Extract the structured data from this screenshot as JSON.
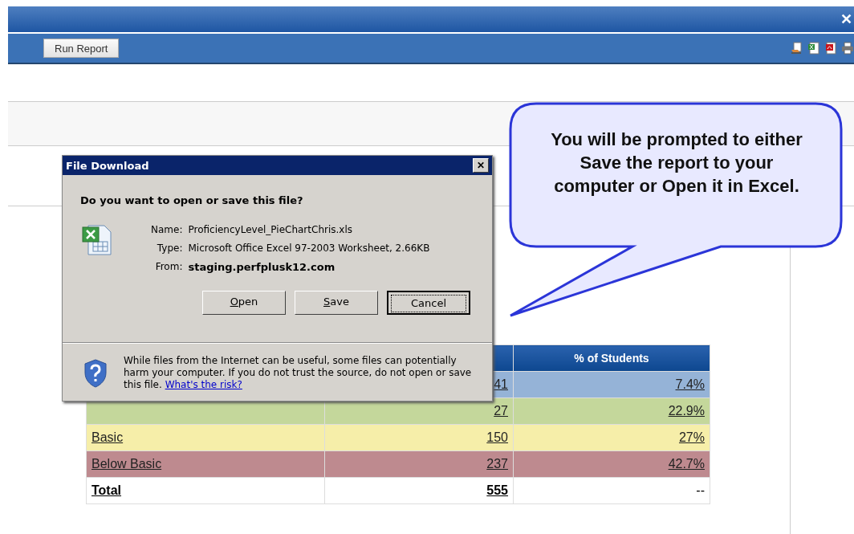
{
  "window": {
    "close": "✕"
  },
  "toolbar": {
    "run_button": "Run Report"
  },
  "table": {
    "column_3_heading": "% of Students",
    "rows": [
      {
        "kind": "level",
        "color": "#95b3d7",
        "count": "41",
        "percent": "7.4%"
      },
      {
        "kind": "level",
        "color": "#c4d79b",
        "count": "27",
        "percent": "22.9%"
      },
      {
        "kind": "level",
        "label": "Basic",
        "color": "#f6eea9",
        "count": "150",
        "percent": "27%"
      },
      {
        "kind": "level",
        "label": "Below Basic",
        "color": "#be8a8f",
        "count": "237",
        "percent": "42.7%"
      },
      {
        "kind": "total",
        "label": "Total",
        "count": "555",
        "percent": "--"
      }
    ]
  },
  "dialog": {
    "title": "File Download",
    "close": "✕",
    "question": "Do you want to open or save this file?",
    "fields": [
      {
        "label": "Name:",
        "value": "ProficiencyLevel_PieChartChris.xls",
        "bold": false
      },
      {
        "label": "Type:",
        "value": "Microsoft Office Excel 97-2003 Worksheet, 2.66KB",
        "bold": false
      },
      {
        "label": "From:",
        "value": "staging.perfplusk12.com",
        "bold": true
      }
    ],
    "buttons": [
      {
        "label": "Open",
        "mnemonic_first": true,
        "default": false
      },
      {
        "label": "Save",
        "mnemonic_first": true,
        "default": false
      },
      {
        "label": "Cancel",
        "mnemonic_first": false,
        "default": true
      }
    ],
    "warning": {
      "text": "While files from the Internet can be useful, some files can potentially harm your computer. If you do not trust the source, do not open or save this file.",
      "link": "What's the risk?"
    }
  },
  "callout": {
    "text": "You will be prompted to either Save the report to your computer or Open it in Excel."
  }
}
